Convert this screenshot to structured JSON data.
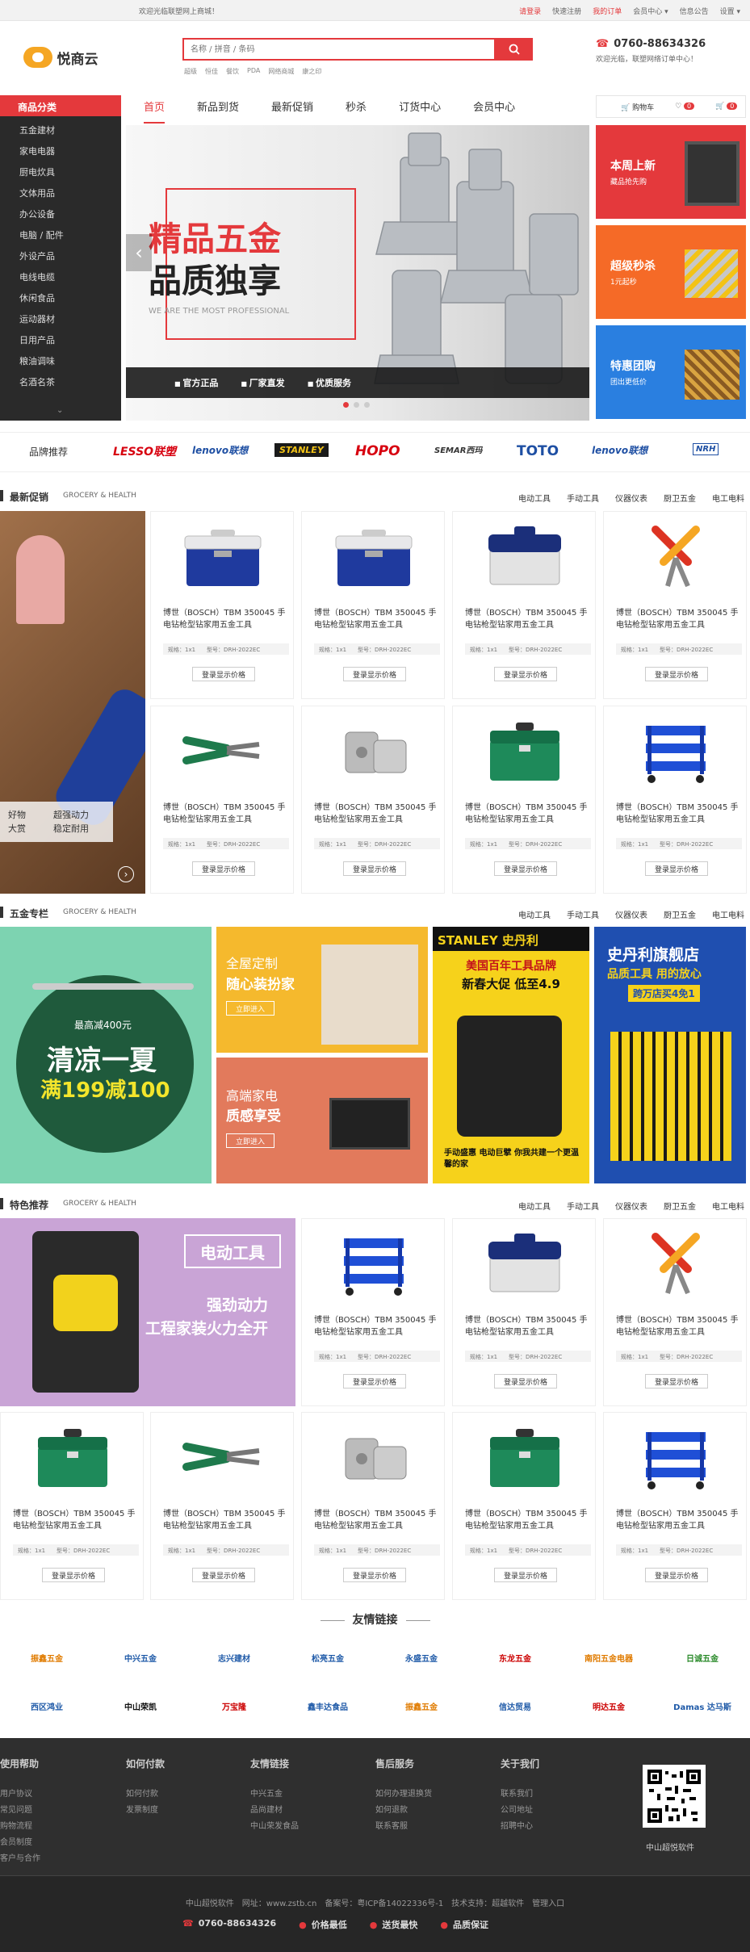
{
  "topbar": {
    "welcome": "欢迎光临联塑网上商城！",
    "links": [
      "请登录",
      "快速注册",
      "我的订单",
      "会员中心 ▾",
      "信息公告",
      "设置 ▾"
    ]
  },
  "logo": {
    "text": "悦商云"
  },
  "search": {
    "placeholder": "名称 / 拼音 / 条码",
    "hot_words": [
      "超级",
      "恒佳",
      "餐饮",
      "PDA",
      "网络商城",
      "康之印"
    ]
  },
  "contact": {
    "phone": "0760-88634326",
    "sub": "欢迎光临，联塑网络订单中心！"
  },
  "category": {
    "header": "商品分类",
    "items": [
      "五金建材",
      "家电电器",
      "厨电炊具",
      "文体用品",
      "办公设备",
      "电脑 / 配件",
      "外设产品",
      "电线电缆",
      "休闲食品",
      "运动器材",
      "日用产品",
      "粮油调味",
      "名酒名茶"
    ],
    "more": "⌄"
  },
  "nav": {
    "items": [
      "首页",
      "新品到货",
      "最新促销",
      "秒杀",
      "订货中心",
      "会员中心"
    ]
  },
  "cart": {
    "label": "购物车",
    "favorites": "0",
    "count": "0"
  },
  "banner": {
    "title1": "精品五金",
    "title2": "品质独享",
    "subtitle": "WE ARE THE MOST PROFESSIONAL",
    "features": [
      "官方正品",
      "厂家直发",
      "优质服务"
    ],
    "active_slide": 1
  },
  "promos": [
    {
      "title": "本周上新",
      "sub": "藏品抢先购",
      "color": "#e4393c"
    },
    {
      "title": "超级秒杀",
      "sub": "1元起秒",
      "color": "#f56a27"
    },
    {
      "title": "特惠团购",
      "sub": "团出更低价",
      "color": "#2a7fe0"
    }
  ],
  "brands": {
    "label": "品牌推荐",
    "items": [
      "LESSO联塑",
      "lenovo联想",
      "STANLEY",
      "HOPO",
      "SEMAR西玛",
      "TOTO",
      "lenovo联想",
      "NRH"
    ]
  },
  "sections": [
    {
      "title": "最新促销",
      "en": "GROCERY & HEALTH",
      "tabs": [
        "电动工具",
        "手动工具",
        "仪器仪表",
        "厨卫五金",
        "电工电料"
      ]
    },
    {
      "title": "五金专栏",
      "en": "GROCERY & HEALTH",
      "tabs": [
        "电动工具",
        "手动工具",
        "仪器仪表",
        "厨卫五金",
        "电工电料"
      ]
    },
    {
      "title": "特色推荐",
      "en": "GROCERY & HEALTH",
      "tabs": [
        "电动工具",
        "手动工具",
        "仪器仪表",
        "厨卫五金",
        "电工电料"
      ]
    }
  ],
  "promo_side": {
    "left": "好物\n大赏",
    "right": "超强动力\n稳定耐用"
  },
  "product": {
    "name": "博世（BOSCH）TBM 350045 手电钻枪型钻家用五金工具",
    "spec": "规格：1x1　　型号：DRH-2022EC",
    "button": "登录显示价格"
  },
  "hardware": {
    "summer_top": "最高减400元",
    "summer_main": "清凉一夏",
    "summer_deal": "满199减100",
    "home_title": "全屋定制",
    "home_sub": "随心装扮家",
    "enter": "立即进入",
    "appliance_title": "高端家电",
    "appliance_sub": "质感享受",
    "stanley_brand": "STANLEY 史丹利",
    "stanley_l1": "美国百年工具品牌",
    "stanley_l2": "新春大促 低至4.9",
    "stanley_foot": "手动盛惠 电动巨擘 你我共建一个更温馨的家",
    "store_title": "史丹利旗舰店",
    "store_l1": "品质工具 用的放心",
    "store_l2": "跨万店买4免1"
  },
  "power_tools": {
    "badge": "电动工具",
    "l1": "强劲动力",
    "l2": "工程家装火力全开"
  },
  "friends": {
    "title": "友情链接",
    "row1": [
      "振鑫五金",
      "中兴五金",
      "志兴建材",
      "松亮五金",
      "永盛五金",
      "东龙五金",
      "南阳五金电器",
      "日诚五金"
    ],
    "row2": [
      "西区鸿业",
      "中山荣凯",
      "万宝隆",
      "鑫丰达食品",
      "振鑫五金",
      "信达贸易",
      "明达五金",
      "Damas 达马斯"
    ]
  },
  "footer": {
    "cols": [
      {
        "title": "使用帮助",
        "links": [
          "用户协议",
          "常见问题",
          "购物流程",
          "会员制度",
          "客户与合作"
        ]
      },
      {
        "title": "如何付款",
        "links": [
          "如何付款",
          "发票制度"
        ]
      },
      {
        "title": "友情链接",
        "links": [
          "中兴五金",
          "品尚建材",
          "中山荣发食品"
        ]
      },
      {
        "title": "售后服务",
        "links": [
          "如何办理退换货",
          "如何退款",
          "联系客服"
        ]
      },
      {
        "title": "关于我们",
        "links": [
          "联系我们",
          "公司地址",
          "招聘中心"
        ]
      }
    ],
    "qr_caption": "中山超悦软件",
    "copyright": "中山超悦软件　网址：www.zstb.cn　备案号：粤ICP备14022336号-1　技术支持：超越软件　管理入口",
    "guarantees": [
      "0760-88634326",
      "价格最低",
      "送货最快",
      "品质保证"
    ]
  }
}
